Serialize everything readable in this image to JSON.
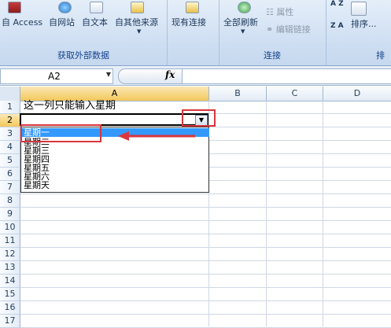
{
  "ribbon": {
    "buttons": {
      "access": "自 Access",
      "web": "自网站",
      "text": "自文本",
      "other": "自其他来源",
      "existing": "现有连接",
      "refresh_all": "全部刷新",
      "properties": "属性",
      "edit_links": "编辑链接",
      "sort": "排序...",
      "sort_az": "A Z",
      "sort_za": "Z A"
    },
    "groups": {
      "get_external": "获取外部数据",
      "connections": "连接",
      "sort_filter": "排"
    }
  },
  "formula_bar": {
    "name_box": "A2",
    "fx": "fx",
    "value": ""
  },
  "columns": [
    "A",
    "B",
    "C",
    "D"
  ],
  "rows": [
    "1",
    "2",
    "3",
    "4",
    "5",
    "6",
    "7",
    "8",
    "9",
    "10",
    "11",
    "12",
    "13",
    "14",
    "15",
    "16",
    "17"
  ],
  "cells": {
    "A1": "这一列只能输入星期"
  },
  "dropdown": {
    "items": [
      "星期一",
      "星期二",
      "星期三",
      "星期四",
      "星期五",
      "星期六",
      "星期天"
    ],
    "selected_index": 0
  },
  "colors": {
    "highlight": "#3399ff",
    "annotation": "#d9363e",
    "ribbon_text": "#15428b"
  }
}
